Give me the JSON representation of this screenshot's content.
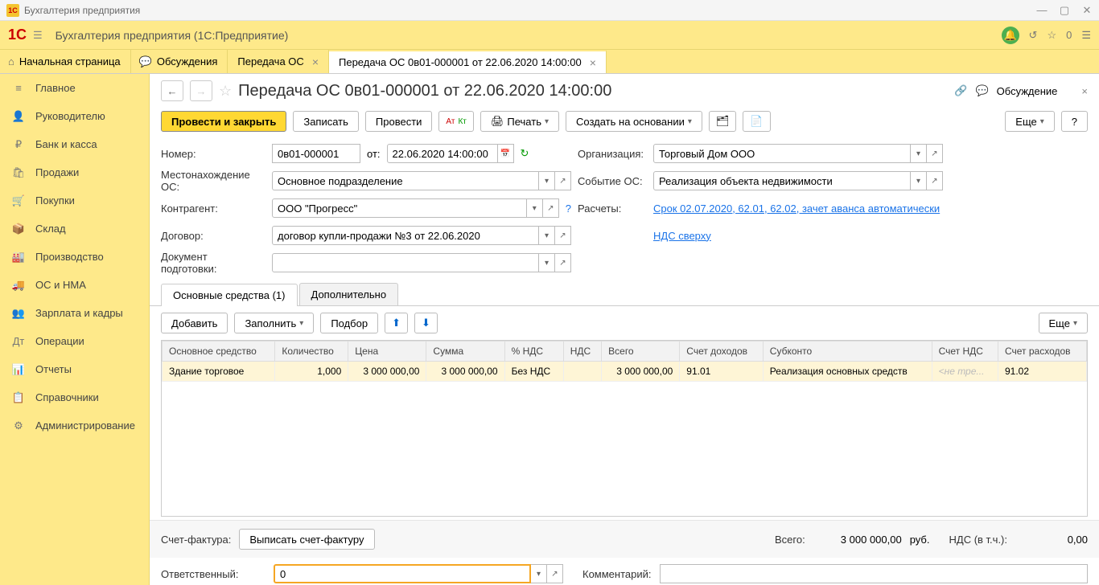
{
  "window": {
    "title": "Бухгалтерия предприятия"
  },
  "header": {
    "title": "Бухгалтерия предприятия  (1С:Предприятие)",
    "zero": "0"
  },
  "tabs": [
    {
      "label": "Начальная страница"
    },
    {
      "label": "Обсуждения"
    },
    {
      "label": "Передача ОС"
    },
    {
      "label": "Передача ОС 0в01-000001 от 22.06.2020 14:00:00"
    }
  ],
  "sidebar": {
    "items": [
      {
        "icon": "≡",
        "label": "Главное"
      },
      {
        "icon": "👤",
        "label": "Руководителю"
      },
      {
        "icon": "₽",
        "label": "Банк и касса"
      },
      {
        "icon": "🛍",
        "label": "Продажи"
      },
      {
        "icon": "🛒",
        "label": "Покупки"
      },
      {
        "icon": "📦",
        "label": "Склад"
      },
      {
        "icon": "🏭",
        "label": "Производство"
      },
      {
        "icon": "🚚",
        "label": "ОС и НМА"
      },
      {
        "icon": "👥",
        "label": "Зарплата и кадры"
      },
      {
        "icon": "Дт",
        "label": "Операции"
      },
      {
        "icon": "📊",
        "label": "Отчеты"
      },
      {
        "icon": "📋",
        "label": "Справочники"
      },
      {
        "icon": "⚙",
        "label": "Администрирование"
      }
    ]
  },
  "doc": {
    "title": "Передача ОС 0в01-000001 от 22.06.2020 14:00:00",
    "discuss": "Обсуждение"
  },
  "toolbar": {
    "post_close": "Провести и закрыть",
    "save": "Записать",
    "post": "Провести",
    "print": "Печать",
    "create_based": "Создать на основании",
    "more": "Еще",
    "help": "?"
  },
  "form": {
    "number_label": "Номер:",
    "number_value": "0в01-000001",
    "from_label": "от:",
    "date_value": "22.06.2020 14:00:00",
    "org_label": "Организация:",
    "org_value": "Торговый Дом ООО",
    "location_label": "Местонахождение ОС:",
    "location_value": "Основное подразделение",
    "event_label": "Событие ОС:",
    "event_value": "Реализация объекта недвижимости",
    "counterparty_label": "Контрагент:",
    "counterparty_value": "ООО \"Прогресс\"",
    "settlements_label": "Расчеты:",
    "settlements_link": "Срок 02.07.2020, 62.01, 62.02, зачет аванса автоматически",
    "contract_label": "Договор:",
    "contract_value": "договор купли-продажи №3 от 22.06.2020",
    "vat_link": "НДС сверху",
    "prep_label": "Документ подготовки:"
  },
  "subtabs": {
    "fixed_assets": "Основные средства (1)",
    "additional": "Дополнительно"
  },
  "subtoolbar": {
    "add": "Добавить",
    "fill": "Заполнить",
    "select": "Подбор",
    "more": "Еще"
  },
  "table": {
    "headers": {
      "asset": "Основное средство",
      "qty": "Количество",
      "price": "Цена",
      "sum": "Сумма",
      "vat_pct": "% НДС",
      "vat": "НДС",
      "total": "Всего",
      "income_acc": "Счет доходов",
      "subconto": "Субконто",
      "vat_acc": "Счет НДС",
      "expense_acc": "Счет расходов"
    },
    "rows": [
      {
        "asset": "Здание торговое",
        "qty": "1,000",
        "price": "3 000 000,00",
        "sum": "3 000 000,00",
        "vat_pct": "Без НДС",
        "vat": "",
        "total": "3 000 000,00",
        "income_acc": "91.01",
        "subconto": "Реализация основных средств",
        "vat_acc": "<не тре...",
        "expense_acc": "91.02"
      }
    ]
  },
  "footer": {
    "invoice_label": "Счет-фактура:",
    "invoice_btn": "Выписать счет-фактуру",
    "total_label": "Всего:",
    "total_value": "3 000 000,00",
    "currency": "руб.",
    "vat_incl_label": "НДС (в т.ч.):",
    "vat_incl_value": "0,00",
    "responsible_label": "Ответственный:",
    "responsible_value": "0",
    "comment_label": "Комментарий:"
  }
}
